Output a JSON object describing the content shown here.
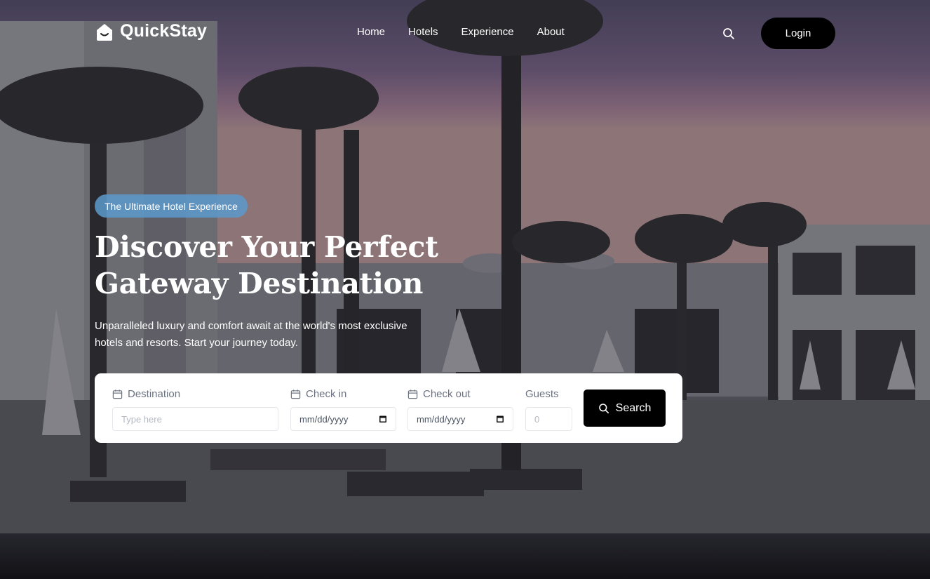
{
  "brand": {
    "name": "QuickStay"
  },
  "nav": {
    "links": [
      "Home",
      "Hotels",
      "Experience",
      "About"
    ],
    "search_icon": "search-icon",
    "login_label": "Login"
  },
  "hero": {
    "badge": "The Ultimate Hotel Experience",
    "headline_line1": "Discover Your Perfect",
    "headline_line2": "Gateway Destination",
    "subtitle_line1": "Unparalleled luxury and comfort await at the world's most exclusive",
    "subtitle_line2": "hotels and resorts. Start your journey today."
  },
  "search_form": {
    "destination": {
      "label": "Destination",
      "placeholder": "Type here",
      "icon": "calendar-icon"
    },
    "check_in": {
      "label": "Check in",
      "value": "mm/dd/yyyy",
      "icon": "calendar-icon"
    },
    "check_out": {
      "label": "Check out",
      "value": "mm/dd/yyyy",
      "icon": "calendar-icon"
    },
    "guests": {
      "label": "Guests",
      "placeholder": "0"
    },
    "submit_label": "Search"
  },
  "colors": {
    "badge": "#5c9acc",
    "login_bg": "#000000",
    "panel_bg": "#ffffff"
  }
}
